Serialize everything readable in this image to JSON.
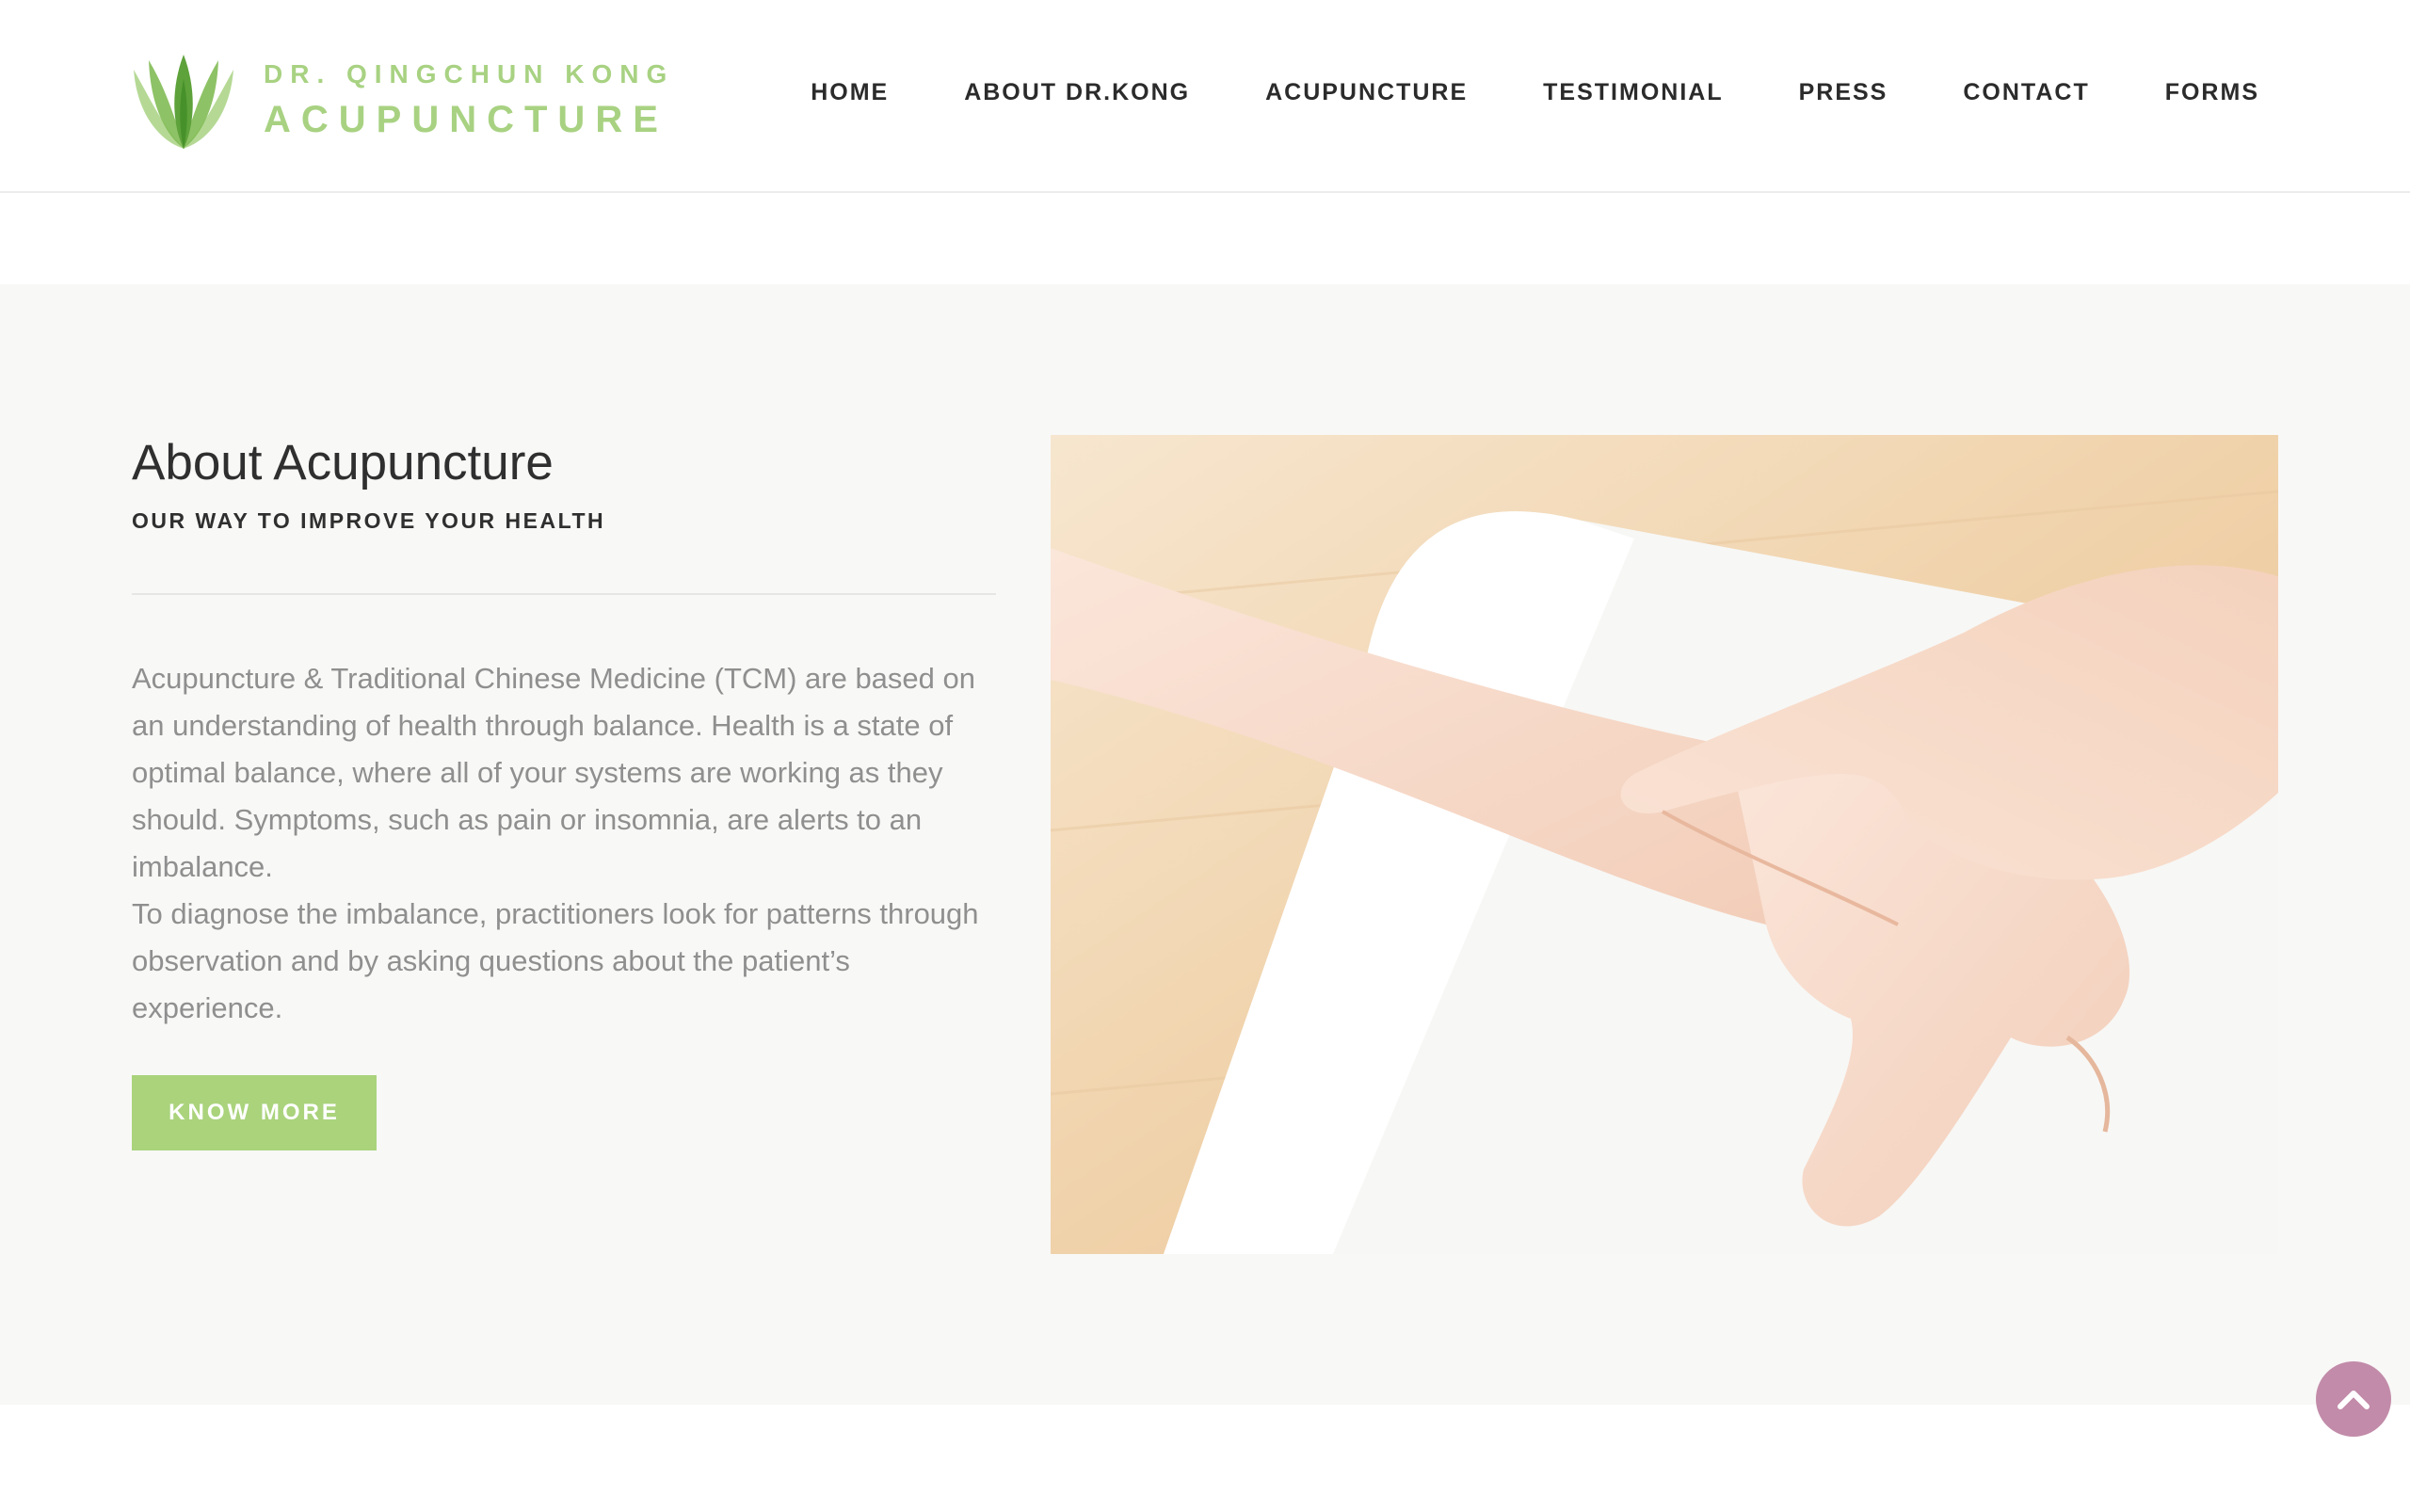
{
  "header": {
    "logo": {
      "line1": "DR. QINGCHUN KONG",
      "line2": "ACUPUNCTURE",
      "icon": "lotus-leaf-icon"
    },
    "nav": {
      "home": "HOME",
      "about": "ABOUT DR.KONG",
      "acupuncture": "ACUPUNCTURE",
      "testimonial": "TESTIMONIAL",
      "press": "PRESS",
      "contact": "CONTACT",
      "forms": "FORMS"
    }
  },
  "about": {
    "title": "About Acupuncture",
    "subtitle": "OUR WAY TO IMPROVE YOUR HEALTH",
    "paragraph1": "Acupuncture & Traditional Chinese Medicine (TCM) are based on an understanding of health through balance. Health is a state of optimal balance, where all of your systems are working as they should. Symptoms, such as pain or insomnia, are alerts to an imbalance.",
    "paragraph2": "To diagnose the imbalance, practitioners look for patterns through observation and by asking questions about the patient’s experience.",
    "button": "KNOW MORE"
  },
  "scroll_top": {
    "icon": "chevron-up-icon"
  },
  "colors": {
    "brand_green": "#a8d282",
    "button_green": "#aad37c",
    "nav_text": "#2b2b2b",
    "body_text": "#8f8f8f",
    "section_bg": "#f8f8f6",
    "scroll_button": "#c28ba9"
  }
}
